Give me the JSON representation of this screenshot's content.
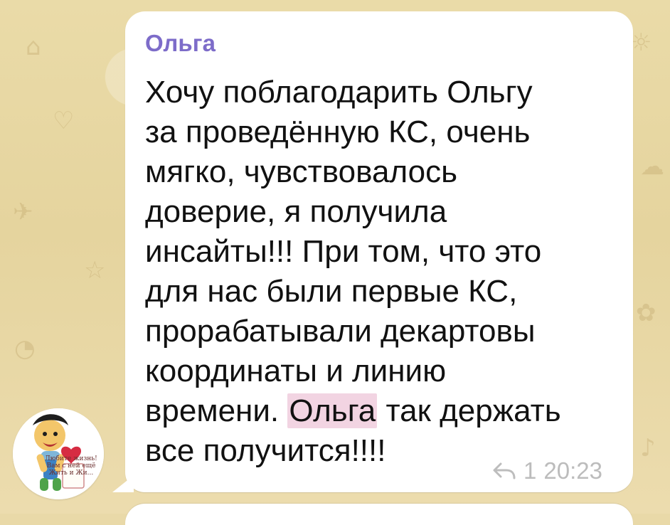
{
  "theme": {
    "chat_background": "#e9d9a8",
    "bubble_background": "#ffffff",
    "sender_color": "#7d6cc9",
    "highlight_color": "#f2d4e2",
    "meta_color": "#bdbdbd"
  },
  "message": {
    "sender": "Ольга",
    "lines": [
      "Хочу поблагодарить Ольгу",
      "за проведённую КС, очень",
      "мягко, чувствовалось",
      "доверие, я получила",
      "инсайты!!! При том, что это",
      "для нас были первые КС,",
      "прорабатывали декартовы",
      "координаты и линию",
      "времени.",
      "Ольга",
      "так держать",
      "все получится!!!!"
    ],
    "replies_count": "1",
    "time": "20:23",
    "reply_icon": "reply-arrow-icon"
  },
  "avatar": {
    "caption_lines": [
      "Любите жизнь!",
      "Вам с ней ещё",
      "Жить и Жи..."
    ]
  }
}
